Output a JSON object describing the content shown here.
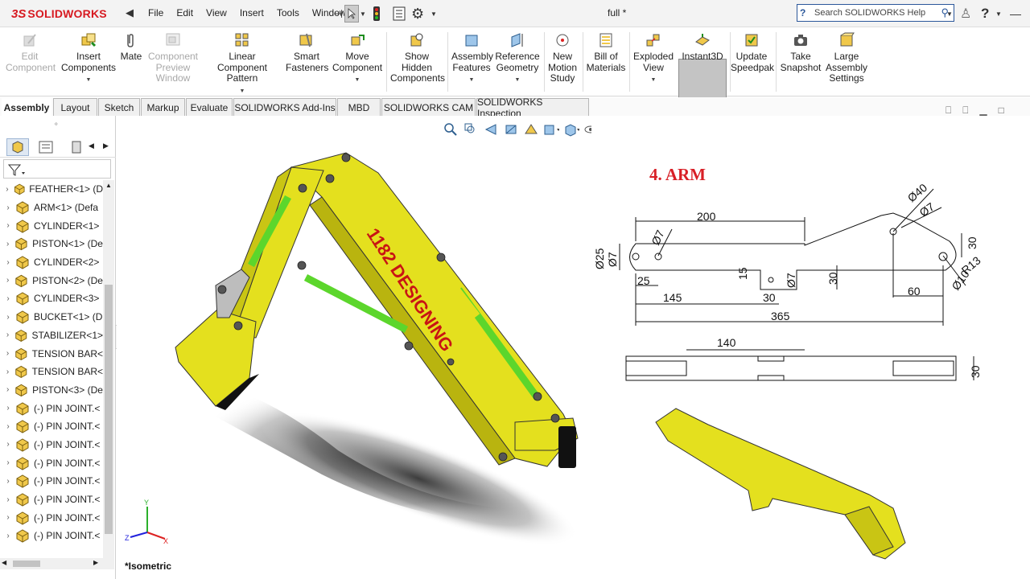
{
  "app": {
    "brand_ds": "3S",
    "brand_name": "SOLIDWORKS",
    "document_title": "full *"
  },
  "menu": [
    "File",
    "Edit",
    "View",
    "Insert",
    "Tools",
    "Window"
  ],
  "search": {
    "placeholder": "Search SOLIDWORKS Help"
  },
  "toolbar": {
    "edit_component": "Edit Component",
    "insert_components": "Insert Components",
    "mate": "Mate",
    "component_preview": "Component Preview Window",
    "linear_pattern": "Linear Component Pattern",
    "smart_fasteners": "Smart Fasteners",
    "move_component": "Move Component",
    "show_hidden": "Show Hidden Components",
    "assembly_features": "Assembly Features",
    "reference_geometry": "Reference Geometry",
    "new_motion": "New Motion Study",
    "bom": "Bill of Materials",
    "exploded": "Exploded View",
    "instant3d": "Instant3D",
    "speedpak": "Update Speedpak",
    "snapshot": "Take Snapshot",
    "large_assembly": "Large Assembly Settings"
  },
  "tabs": [
    "Assembly",
    "Layout",
    "Sketch",
    "Markup",
    "Evaluate",
    "SOLIDWORKS Add-Ins",
    "MBD",
    "SOLIDWORKS CAM",
    "SOLIDWORKS Inspection"
  ],
  "tree": [
    "FEATHER<1> (D",
    "ARM<1> (Defa",
    "CYLINDER<1>",
    "PISTON<1> (De",
    "CYLINDER<2>",
    "PISTON<2> (De",
    "CYLINDER<3>",
    "BUCKET<1> (D",
    "STABILIZER<1>",
    "TENSION BAR<",
    "TENSION BAR<",
    "PISTON<3> (De",
    "(-) PIN JOINT.<",
    "(-) PIN JOINT.<",
    "(-) PIN JOINT.<",
    "(-) PIN JOINT.<",
    "(-) PIN JOINT.<",
    "(-) PIN JOINT.<",
    "(-) PIN JOINT.<",
    "(-) PIN JOINT.<"
  ],
  "viewport": {
    "model_text": "1182 DESIGNING",
    "view_label": "*Isometric",
    "axis_x": "X",
    "axis_y": "Y",
    "axis_z": "Z"
  },
  "drawing": {
    "title": "4. ARM",
    "dims": {
      "d200": "200",
      "d40": "Ø40",
      "d7a": "Ø7",
      "d7b": "Ø7",
      "d25": "Ø25",
      "d7c": "Ø7",
      "d30a": "30",
      "r13": "R13",
      "d10": "Ø10",
      "d25b": "25",
      "d15": "15",
      "d7d": "Ø7",
      "d30b": "30",
      "d145": "145",
      "d30c": "30",
      "d60": "60",
      "d365": "365",
      "d140": "140",
      "d30d": "30"
    }
  },
  "colors": {
    "accent": "#d71a21",
    "arm_yellow": "#e4e01e",
    "piston_green": "#5cd62c",
    "title_red": "#d81f26"
  }
}
